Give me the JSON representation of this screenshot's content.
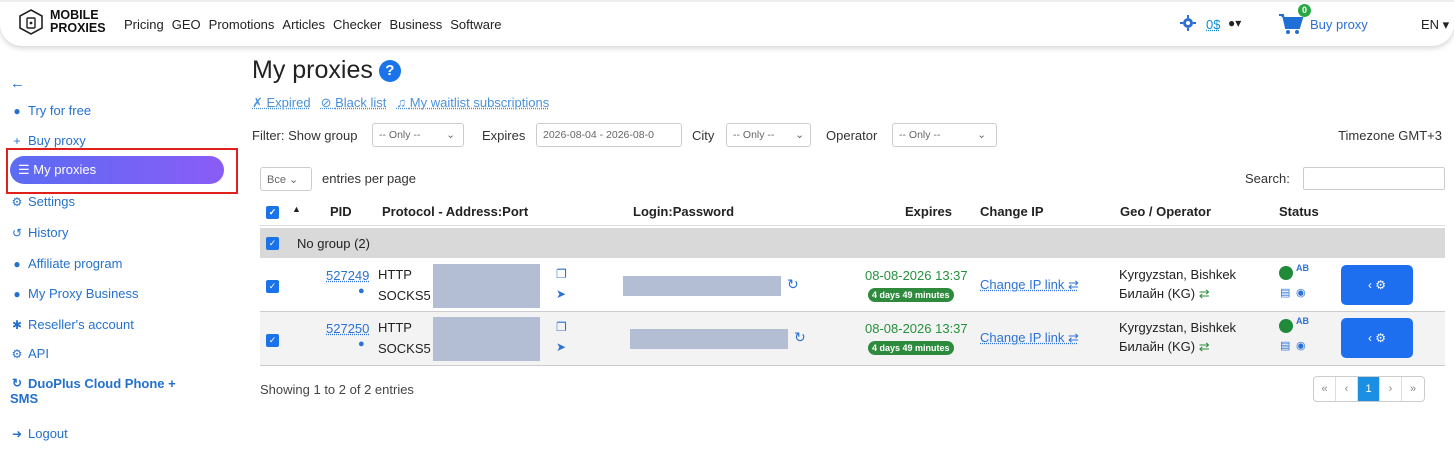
{
  "brand": {
    "line1": "MOBILE",
    "line2": "PROXIES"
  },
  "nav": [
    "Pricing",
    "GEO",
    "Promotions",
    "Articles",
    "Checker",
    "Business",
    "Software"
  ],
  "topright": {
    "balance": "0$",
    "cart_count": "0",
    "buy_proxy": "Buy proxy",
    "lang": "EN"
  },
  "sidebar": {
    "back": "←",
    "items": [
      {
        "label": "Try for free",
        "icon": "fire-icon"
      },
      {
        "label": "Buy proxy",
        "icon": "plus-icon"
      },
      {
        "label": "My proxies",
        "icon": "list-icon"
      },
      {
        "label": "Settings",
        "icon": "user-gear-icon"
      },
      {
        "label": "History",
        "icon": "history-icon"
      },
      {
        "label": "Affiliate program",
        "icon": "users-icon"
      },
      {
        "label": "My Proxy Business",
        "icon": "handshake-icon"
      },
      {
        "label": "Reseller's account",
        "icon": "gears-icon"
      },
      {
        "label": "API",
        "icon": "cogs-icon"
      },
      {
        "label": "DuoPlus Cloud Phone +",
        "label2": "SMS",
        "icon": "duoplus-icon"
      },
      {
        "label": "Logout",
        "icon": "logout-icon"
      }
    ]
  },
  "page": {
    "title": "My proxies",
    "help": "?",
    "sublinks": [
      "Expired",
      "Black list",
      "My waitlist subscriptions"
    ]
  },
  "filters": {
    "show_group_label": "Filter: Show group",
    "show_group_value": "-- Only --",
    "expires_label": "Expires",
    "expires_value": "2026-08-04 - 2026-08-0",
    "city_label": "City",
    "city_value": "-- Only --",
    "operator_label": "Operator",
    "operator_value": "-- Only --",
    "timezone": "Timezone GMT+3"
  },
  "table_controls": {
    "entries_value": "Все",
    "entries_label": "entries per page",
    "search_label": "Search:"
  },
  "columns": {
    "pid": "PID",
    "protocol": "Protocol - Address:Port",
    "login": "Login:Password",
    "expires": "Expires",
    "change_ip": "Change IP",
    "geo": "Geo / Operator",
    "status": "Status"
  },
  "group": {
    "label": "No group (2)"
  },
  "rows": [
    {
      "pid": "527249",
      "proto1": "HTTP",
      "proto2": "SOCKS5",
      "expires": "08-08-2026 13:37",
      "remaining": "4 days 49 minutes",
      "change_ip": "Change IP link",
      "geo": "Kyrgyzstan, Bishkek",
      "operator": "Билайн (KG)"
    },
    {
      "pid": "527250",
      "proto1": "HTTP",
      "proto2": "SOCKS5",
      "expires": "08-08-2026 13:37",
      "remaining": "4 days 49 minutes",
      "change_ip": "Change IP link",
      "geo": "Kyrgyzstan, Bishkek",
      "operator": "Билайн (KG)"
    }
  ],
  "footer": {
    "showing": "Showing 1 to 2 of 2 entries",
    "pager": [
      "«",
      "‹",
      "1",
      "›",
      "»"
    ]
  },
  "colors": {
    "accent": "#1a73e8",
    "sidebar_link": "#2471cc",
    "highlight_border": "#e0201b",
    "status_green": "#2e8b3e"
  }
}
